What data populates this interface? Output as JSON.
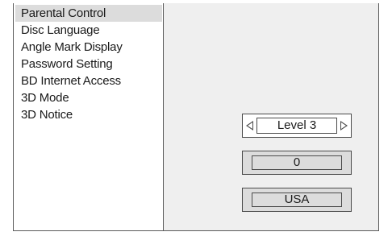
{
  "menu": {
    "items": [
      {
        "label": "Parental Control"
      },
      {
        "label": "Disc Language"
      },
      {
        "label": "Angle Mark Display"
      },
      {
        "label": "Password Setting"
      },
      {
        "label": "BD Internet Access"
      },
      {
        "label": "3D Mode"
      },
      {
        "label": "3D Notice"
      }
    ]
  },
  "panel": {
    "level_selector": {
      "value": "Level 3",
      "left_icon": "triangle-left-icon",
      "right_icon": "triangle-right-icon"
    },
    "password_value": "0",
    "country_value": "USA"
  }
}
